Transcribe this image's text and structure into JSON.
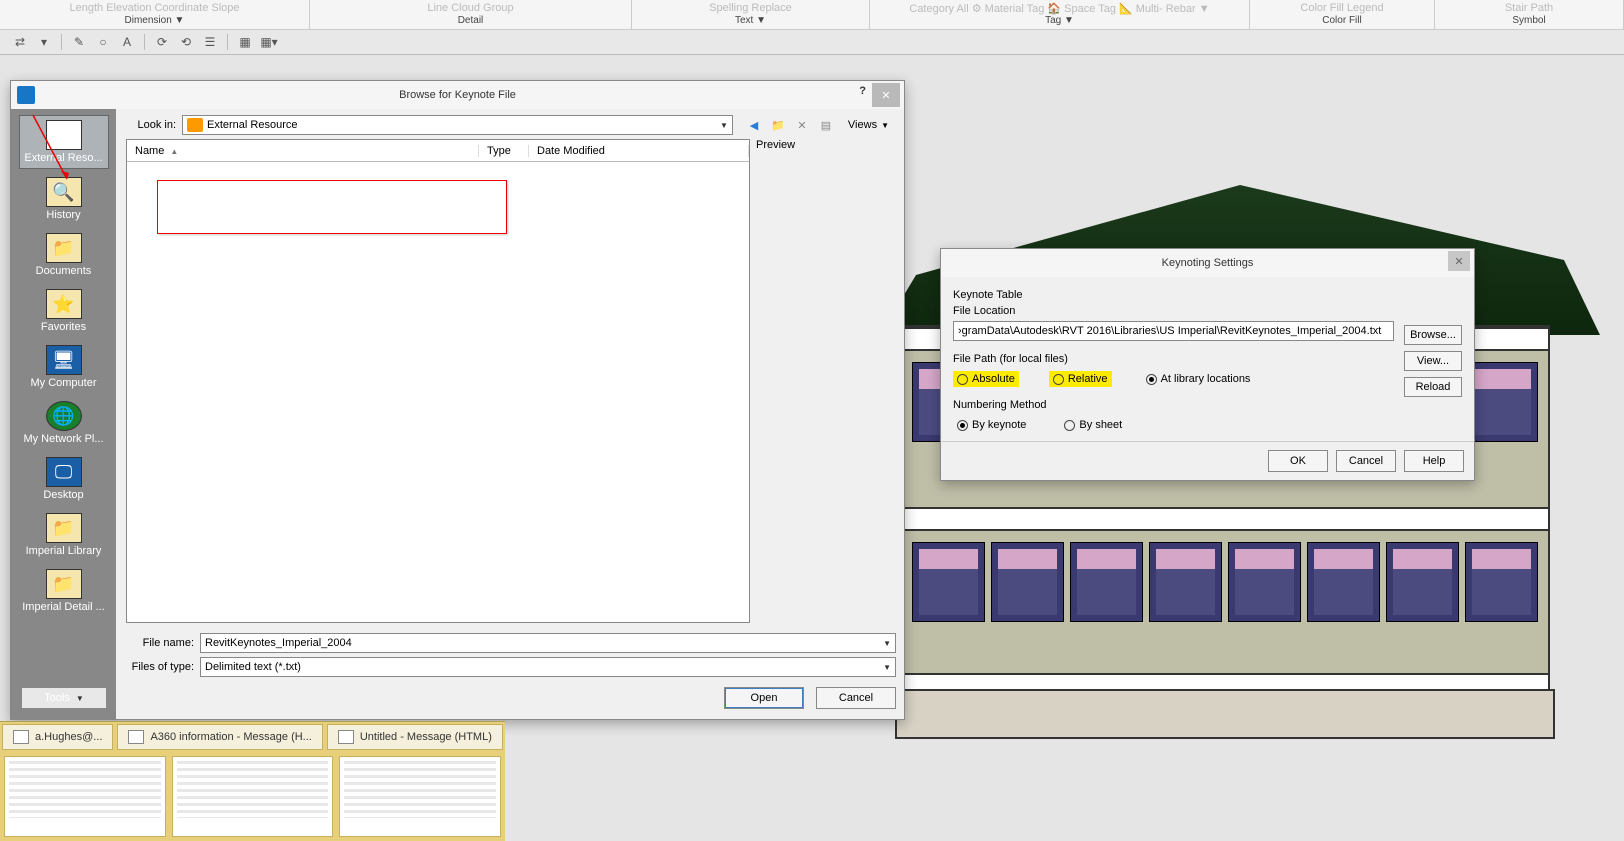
{
  "ribbon": {
    "dimension": {
      "faded": "Length    Elevation    Coordinate    Slope",
      "label": "Dimension ▼"
    },
    "detail": {
      "faded": "Line            Cloud     Group",
      "label": "Detail"
    },
    "text": {
      "faded": "Spelling  Replace",
      "label": "Text ▼"
    },
    "tag": {
      "faded": "Category   All   ⚙ Material Tag   🏠 Space Tag  📐 Multi- Rebar ▼",
      "label": "Tag ▼"
    },
    "colorfill": {
      "faded": "Color Fill Legend",
      "label": "Color Fill"
    },
    "symbol": {
      "faded": "Stair Path",
      "label": "Symbol"
    }
  },
  "browse": {
    "title": "Browse for Keynote File",
    "lookin_label": "Look in:",
    "lookin_value": "External Resource",
    "views": "Views",
    "preview": "Preview",
    "tools": "Tools",
    "columns": {
      "name": "Name",
      "type": "Type",
      "date": "Date Modified"
    },
    "fname_label": "File name:",
    "fname_value": "RevitKeynotes_Imperial_2004",
    "ftype_label": "Files of type:",
    "ftype_value": "Delimited text (*.txt)",
    "open": "Open",
    "cancel": "Cancel",
    "places": {
      "ext": "External Reso...",
      "history": "History",
      "docs": "Documents",
      "fav": "Favorites",
      "comp": "My Computer",
      "net": "My Network Pl...",
      "desk": "Desktop",
      "imp": "Imperial Library",
      "imd": "Imperial Detail ..."
    }
  },
  "kn": {
    "title": "Keynoting Settings",
    "kt": "Keynote Table",
    "fl": "File Location",
    "path": "›gramData\\Autodesk\\RVT 2016\\Libraries\\US Imperial\\RevitKeynotes_Imperial_2004.txt",
    "browse": "Browse...",
    "view": "View...",
    "reload": "Reload",
    "fp": "File Path (for local files)",
    "abs": "Absolute",
    "rel": "Relative",
    "lib": "At library locations",
    "nm": "Numbering Method",
    "byk": "By keynote",
    "bys": "By sheet",
    "ok": "OK",
    "cancel": "Cancel",
    "help": "Help"
  },
  "taskbar": {
    "t1": "a.Hughes@...",
    "t2": "A360 information - Message (H...",
    "t3": "Untitled - Message (HTML)"
  }
}
